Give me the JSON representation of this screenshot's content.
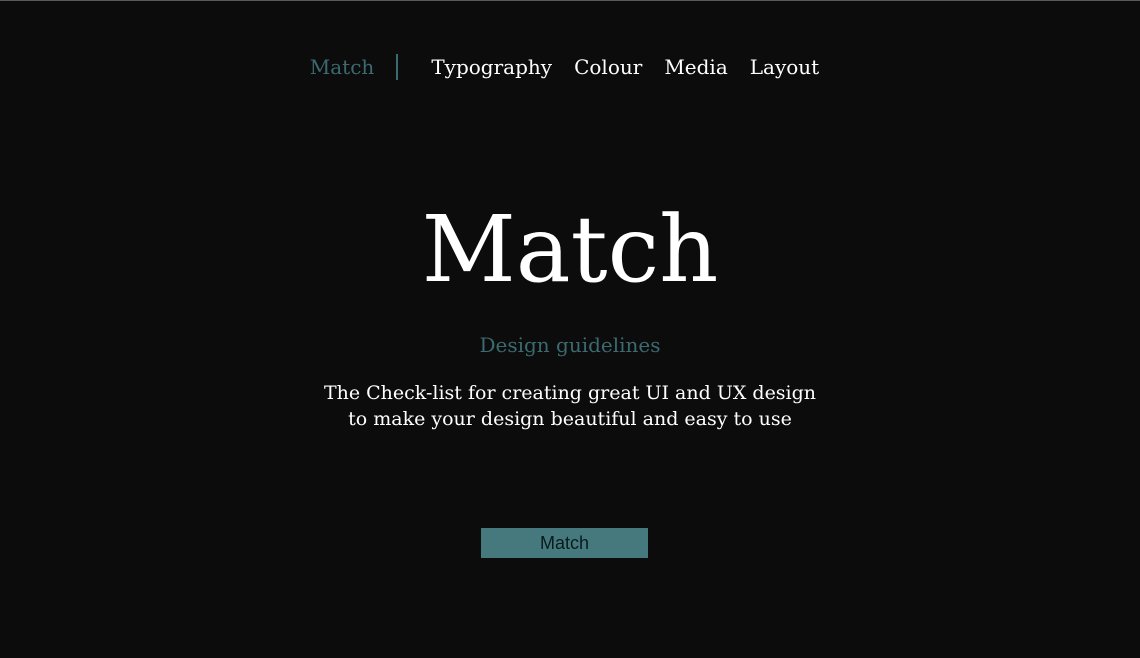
{
  "nav": {
    "brand": "Match",
    "links": [
      {
        "label": "Typography"
      },
      {
        "label": "Colour"
      },
      {
        "label": "Media"
      },
      {
        "label": "Layout"
      }
    ]
  },
  "hero": {
    "title": "Match",
    "subtitle": "Design guidelines",
    "description_line1": "The Check-list for creating great UI and UX design",
    "description_line2": "to make your design beautiful and easy to use"
  },
  "cta": {
    "label": "Match"
  },
  "colors": {
    "background": "#0c0c0c",
    "accent": "#3b6a70",
    "button": "#45797e",
    "text": "#ffffff"
  }
}
